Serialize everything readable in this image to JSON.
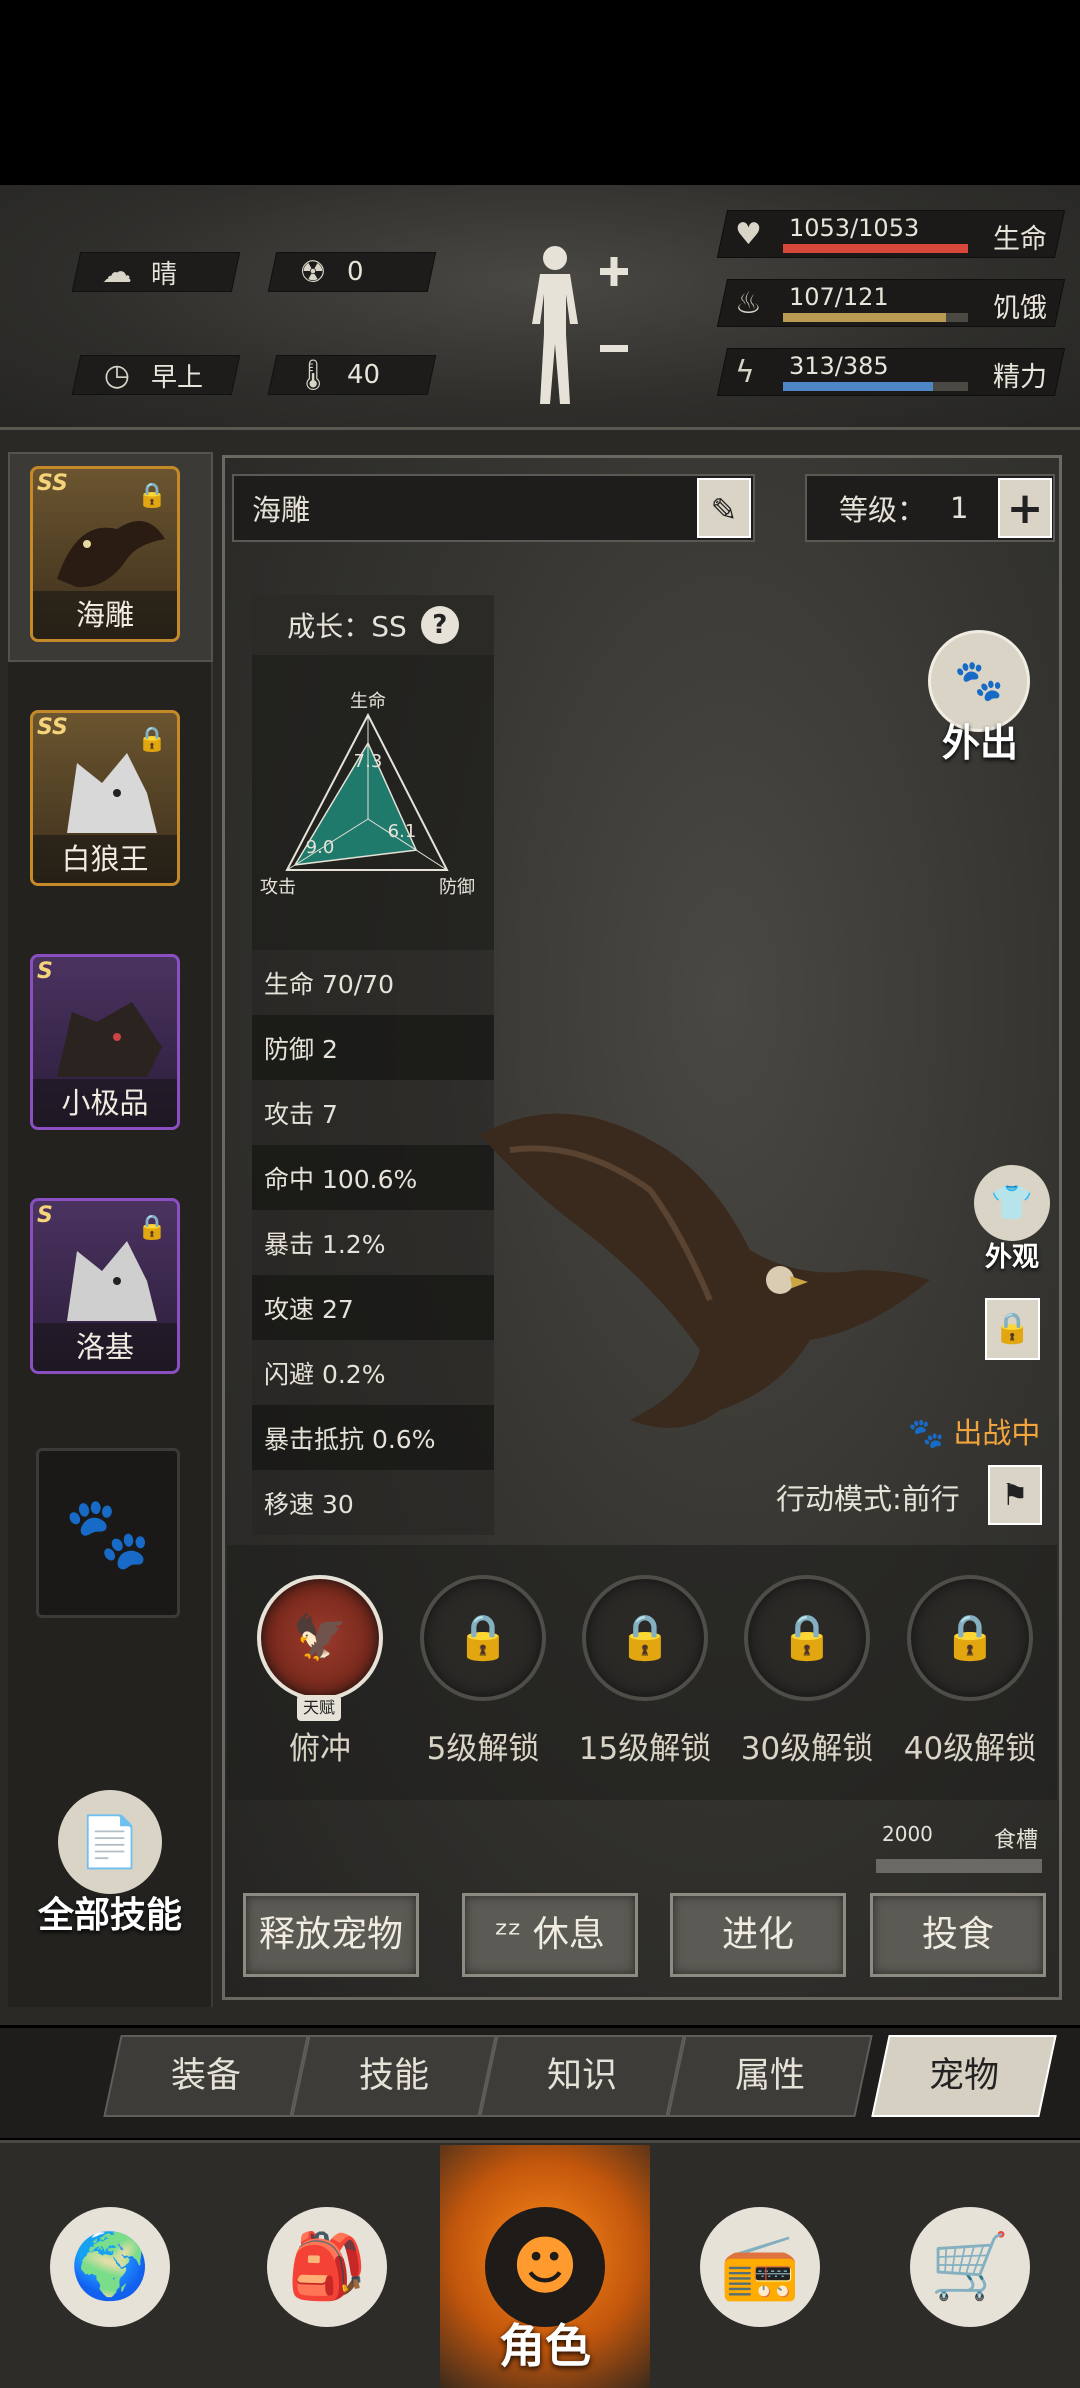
{
  "status": {
    "weather": "晴",
    "radiation": "0",
    "time_of_day": "早上",
    "temperature": "40",
    "health": {
      "value": "1053/1053",
      "label": "生命",
      "fill": 1.0,
      "color": "#d9463a"
    },
    "hunger": {
      "value": "107/121",
      "label": "饥饿",
      "fill": 0.88,
      "color": "#b89a52"
    },
    "energy": {
      "value": "313/385",
      "label": "精力",
      "fill": 0.81,
      "color": "#4f86c6"
    }
  },
  "pets": [
    {
      "grade": "SS",
      "name": "海雕",
      "locked": true,
      "rarity": "gold",
      "selected": true
    },
    {
      "grade": "SS",
      "name": "白狼王",
      "locked": true,
      "rarity": "gold",
      "selected": false
    },
    {
      "grade": "S",
      "name": "小极品",
      "locked": false,
      "rarity": "purple",
      "selected": false
    },
    {
      "grade": "S",
      "name": "洛基",
      "locked": true,
      "rarity": "purple",
      "selected": false
    }
  ],
  "all_skills_label": "全部技能",
  "pet_detail": {
    "name": "海雕",
    "level_label": "等级：",
    "level": "1",
    "growth": "成长：SS",
    "radar": {
      "axes": [
        "生命",
        "攻击",
        "防御"
      ],
      "values": [
        "7.3",
        "9.0",
        "6.1"
      ]
    },
    "stats": [
      "生命 70/70",
      "防御 2",
      "攻击 7",
      "命中 100.6%",
      "暴击 1.2%",
      "攻速 27",
      "闪避 0.2%",
      "暴击抵抗 0.6%",
      "移速 30"
    ],
    "outing_label": "外出",
    "skin_label": "外观",
    "battle_status": "出战中",
    "action_mode": "行动模式:前行"
  },
  "skills": [
    {
      "label": "俯冲",
      "tag": "天赋",
      "locked": false
    },
    {
      "label": "5级解锁",
      "locked": true
    },
    {
      "label": "15级解锁",
      "locked": true
    },
    {
      "label": "30级解锁",
      "locked": true
    },
    {
      "label": "40级解锁",
      "locked": true
    }
  ],
  "trough": {
    "value": "2000",
    "label": "食槽",
    "fill": 0.0
  },
  "actions": [
    "释放宠物",
    "休息",
    "进化",
    "投食"
  ],
  "tabs": [
    "装备",
    "技能",
    "知识",
    "属性",
    "宠物"
  ],
  "active_tab": "宠物",
  "nav": [
    {
      "icon": "globe-icon"
    },
    {
      "icon": "backpack-icon"
    },
    {
      "icon": "character-icon",
      "label": "角色",
      "active": true
    },
    {
      "icon": "radio-icon"
    },
    {
      "icon": "cart-icon"
    }
  ]
}
